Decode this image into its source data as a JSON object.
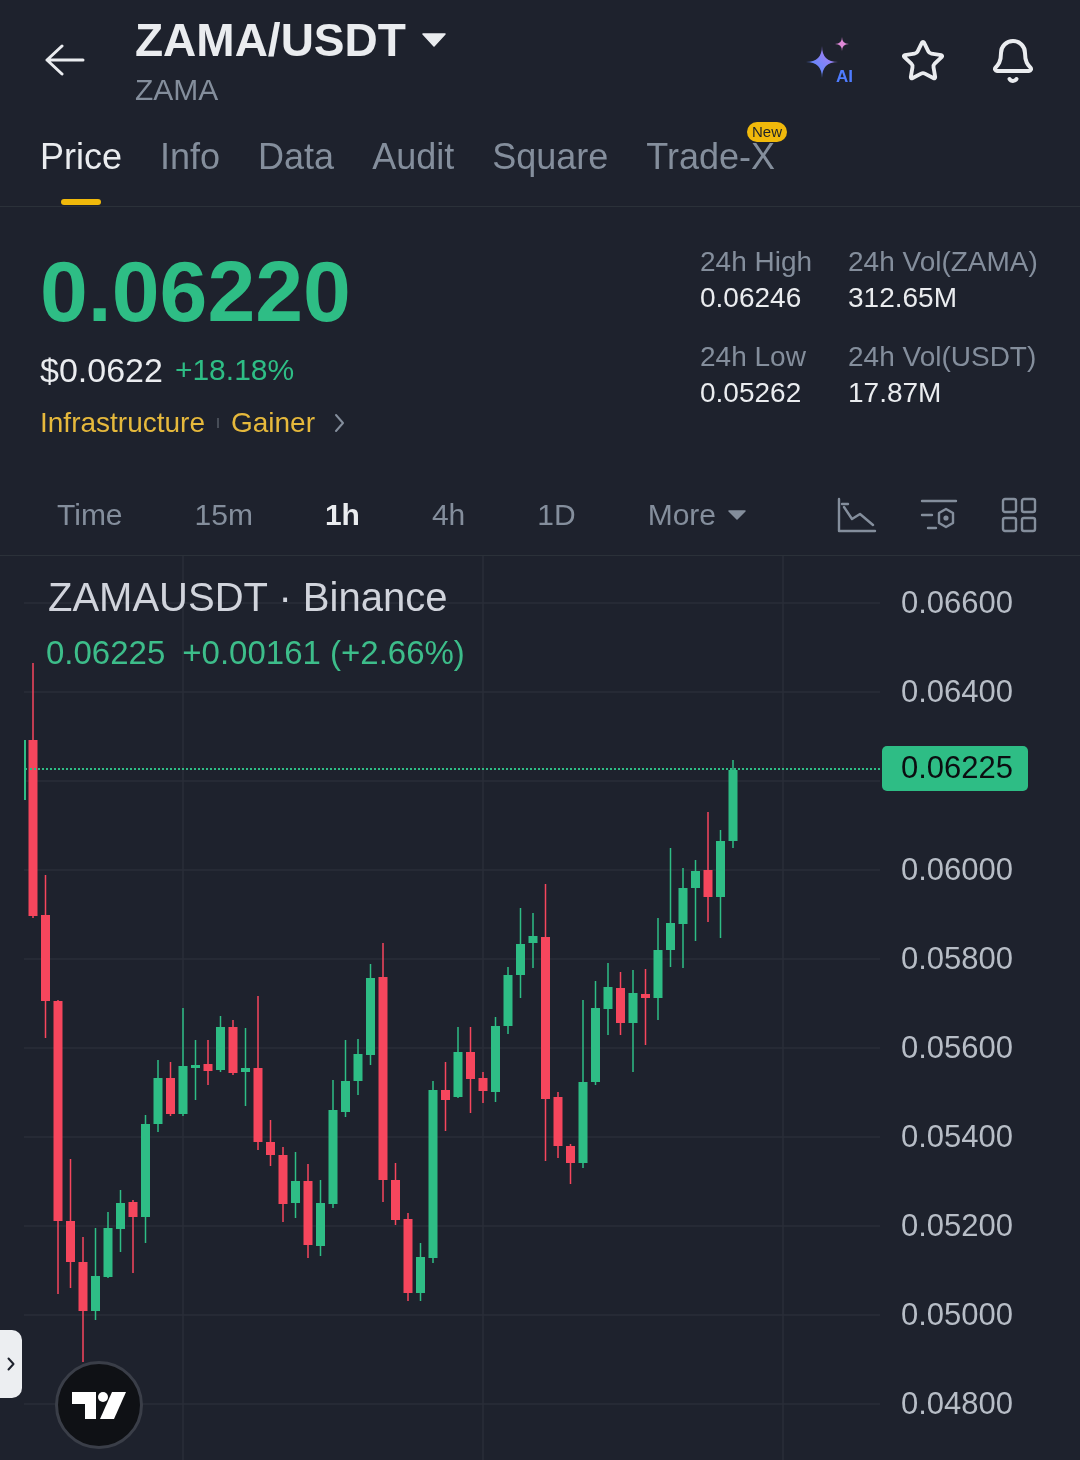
{
  "header": {
    "title": "ZAMA/USDT",
    "subtitle": "ZAMA",
    "ai_label": "AI"
  },
  "tabs": [
    {
      "label": "Price",
      "selected": true
    },
    {
      "label": "Info",
      "selected": false
    },
    {
      "label": "Data",
      "selected": false
    },
    {
      "label": "Audit",
      "selected": false
    },
    {
      "label": "Square",
      "selected": false
    },
    {
      "label": "Trade-X",
      "selected": false,
      "badge": "New"
    }
  ],
  "ticker": {
    "last_price": "0.06220",
    "usd_price": "$0.0622",
    "change": "+18.18%",
    "tags": [
      "Infrastructure",
      "Gainer"
    ]
  },
  "stats": [
    {
      "label": "24h High",
      "value": "0.06246"
    },
    {
      "label": "24h Vol(ZAMA)",
      "value": "312.65M"
    },
    {
      "label": "24h Low",
      "value": "0.05262"
    },
    {
      "label": "24h Vol(USDT)",
      "value": "17.87M"
    }
  ],
  "intervals": [
    {
      "label": "Time",
      "kind": "option",
      "selected": false
    },
    {
      "label": "15m",
      "kind": "option",
      "selected": false
    },
    {
      "label": "1h",
      "kind": "option",
      "selected": true
    },
    {
      "label": "4h",
      "kind": "option",
      "selected": false
    },
    {
      "label": "1D",
      "kind": "option",
      "selected": false
    },
    {
      "label": "More",
      "kind": "dropdown",
      "selected": false
    }
  ],
  "chart": {
    "title": "ZAMAUSDT · Binance",
    "last": "0.06225",
    "change": "+0.00161 (+2.66%)",
    "price_axis": [
      {
        "label": "0.06600",
        "kind": "tick"
      },
      {
        "label": "0.06400",
        "kind": "tick"
      },
      {
        "label": "0.06225",
        "kind": "current"
      },
      {
        "label": "0.06000",
        "kind": "tick"
      },
      {
        "label": "0.05800",
        "kind": "tick"
      },
      {
        "label": "0.05600",
        "kind": "tick"
      },
      {
        "label": "0.05400",
        "kind": "tick"
      },
      {
        "label": "0.05200",
        "kind": "tick"
      },
      {
        "label": "0.05000",
        "kind": "tick"
      },
      {
        "label": "0.04800",
        "kind": "tick"
      }
    ]
  }
}
